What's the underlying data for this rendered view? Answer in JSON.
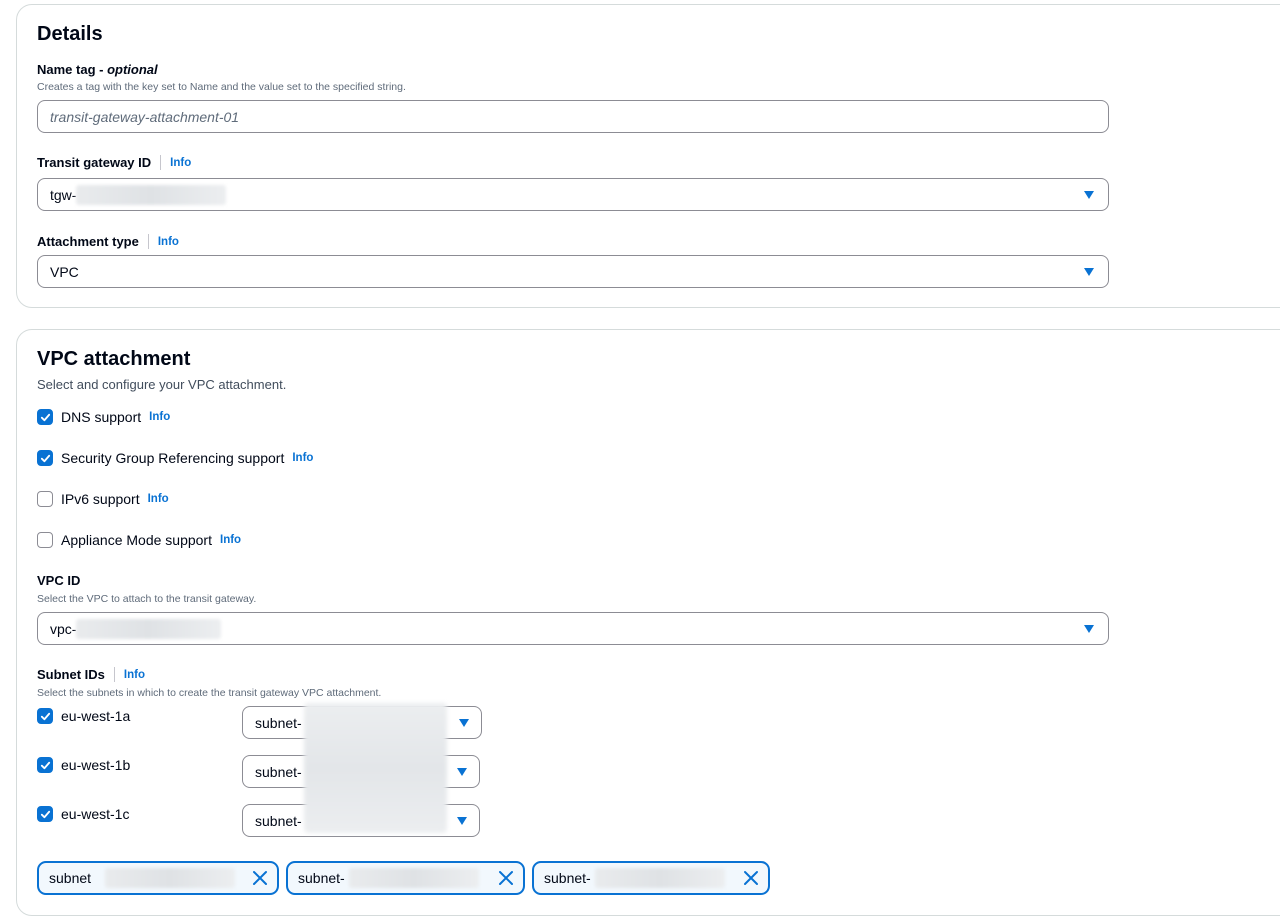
{
  "details": {
    "heading": "Details",
    "name_tag": {
      "label": "Name tag",
      "optional": "optional",
      "description": "Creates a tag with the key set to Name and the value set to the specified string.",
      "placeholder": "transit-gateway-attachment-01"
    },
    "transit_gateway": {
      "label": "Transit gateway ID",
      "info": "Info",
      "value_prefix": "tgw-"
    },
    "attachment_type": {
      "label": "Attachment type",
      "info": "Info",
      "value": "VPC"
    }
  },
  "vpc_attachment": {
    "heading": "VPC attachment",
    "subtitle": "Select and configure your VPC attachment.",
    "options": [
      {
        "label": "DNS support",
        "info": "Info",
        "checked": true
      },
      {
        "label": "Security Group Referencing support",
        "info": "Info",
        "checked": true
      },
      {
        "label": "IPv6 support",
        "info": "Info",
        "checked": false
      },
      {
        "label": "Appliance Mode support",
        "info": "Info",
        "checked": false
      }
    ],
    "vpc_id": {
      "label": "VPC ID",
      "description": "Select the VPC to attach to the transit gateway.",
      "value_prefix": "vpc-"
    },
    "subnet_ids": {
      "label": "Subnet IDs",
      "info": "Info",
      "description": "Select the subnets in which to create the transit gateway VPC attachment.",
      "zones": [
        {
          "zone": "eu-west-1a",
          "checked": true,
          "value_prefix": "subnet-"
        },
        {
          "zone": "eu-west-1b",
          "checked": true,
          "value_prefix": "subnet-"
        },
        {
          "zone": "eu-west-1c",
          "checked": true,
          "value_prefix": "subnet-"
        }
      ],
      "tokens": [
        {
          "label": "subnet"
        },
        {
          "label": "subnet-"
        },
        {
          "label": "subnet-"
        }
      ]
    }
  },
  "colors": {
    "accent": "#0972d3",
    "border": "#8c8c94",
    "text": "#000716",
    "muted": "#5f6b7a"
  },
  "icons": {
    "checkbox": "check-icon",
    "dropdown": "caret-down-icon",
    "remove": "close-icon"
  }
}
